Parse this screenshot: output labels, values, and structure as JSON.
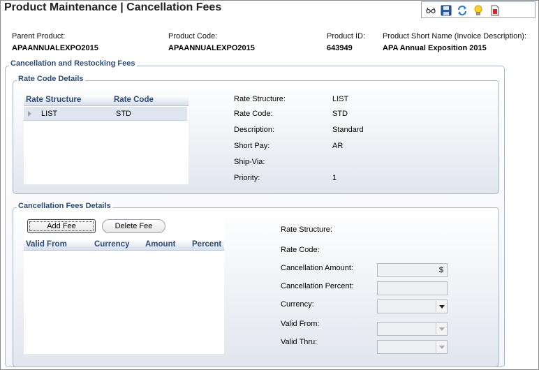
{
  "page": {
    "title": "Product Maintenance  |  Cancellation Fees"
  },
  "toolbar": {
    "icons": [
      "glasses-icon",
      "save-icon",
      "refresh-icon",
      "lightbulb-icon",
      "report-icon"
    ]
  },
  "header": {
    "parent_product_label": "Parent Product:",
    "parent_product_value": "APAANNUALEXPO2015",
    "product_code_label": "Product Code:",
    "product_code_value": "APAANNUALEXPO2015",
    "product_id_label": "Product ID:",
    "product_id_value": "643949",
    "short_name_label": "Product Short Name (Invoice Description):",
    "short_name_value": "APA Annual Exposition 2015"
  },
  "main": {
    "group_title": "Cancellation and Restocking Fees",
    "rate_code_details": {
      "title": "Rate Code Details",
      "columns": [
        "Rate Structure",
        "Rate Code"
      ],
      "rows": [
        {
          "rate_structure": "LIST",
          "rate_code": "STD"
        }
      ],
      "details": [
        {
          "label": "Rate Structure:",
          "value": "LIST"
        },
        {
          "label": "Rate Code:",
          "value": "STD"
        },
        {
          "label": "Description:",
          "value": "Standard"
        },
        {
          "label": "Short Pay:",
          "value": "AR"
        },
        {
          "label": "Ship-Via:",
          "value": ""
        },
        {
          "label": "Priority:",
          "value": "1"
        }
      ]
    },
    "cancellation_fees": {
      "title": "Cancellation Fees Details",
      "add_label": "Add Fee",
      "delete_label": "Delete Fee",
      "columns": [
        "Valid From",
        "Currency",
        "Amount",
        "Percent"
      ],
      "rate_structure_label": "Rate Structure:",
      "rate_code_label": "Rate Code:",
      "cancellation_amount_label": "Cancellation Amount:",
      "cancellation_amount_suffix": "$",
      "cancellation_percent_label": "Cancellation Percent:",
      "currency_label": "Currency:",
      "valid_from_label": "Valid From:",
      "valid_thru_label": "Valid Thru:"
    }
  }
}
